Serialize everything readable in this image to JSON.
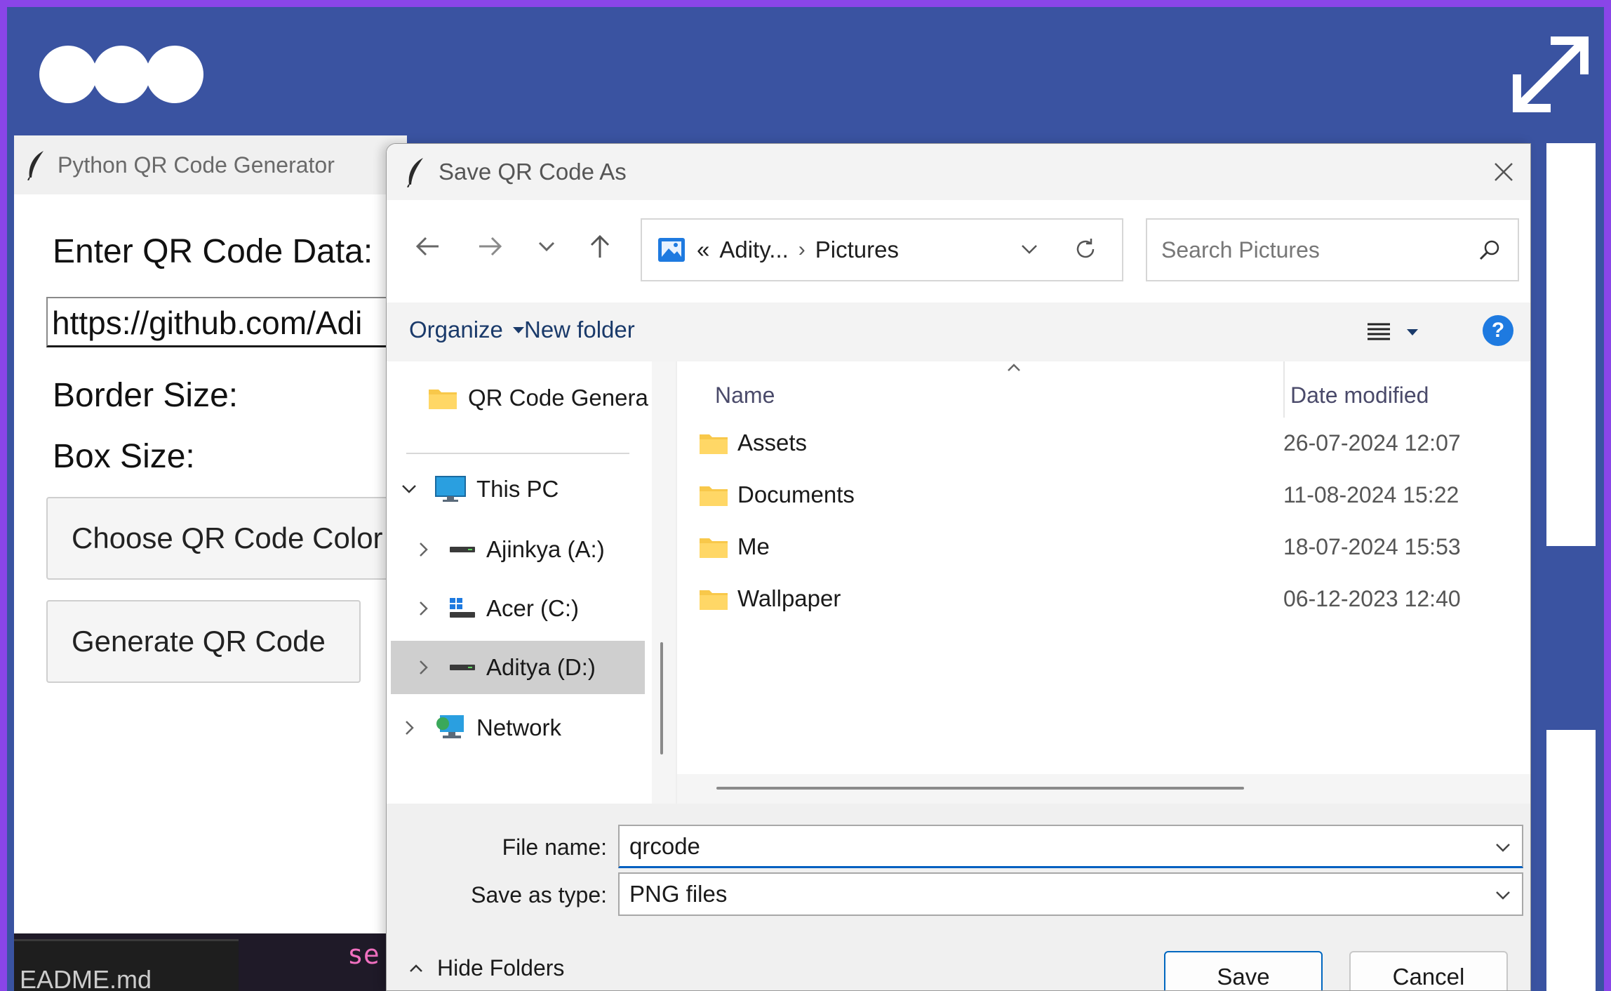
{
  "frame": {
    "colors": {
      "background": "#3a53a1",
      "border": "#8a45e8",
      "dots": "#ffffff"
    },
    "controls": [
      "window-dot-icon",
      "window-dot-icon",
      "window-dot-icon",
      "expand-icon"
    ]
  },
  "qr_app": {
    "title": "Python QR Code Generator",
    "icon": "feather-icon",
    "data_label": "Enter QR Code Data:",
    "data_value": "https://github.com/Adi",
    "border_label": "Border Size:",
    "box_label": "Box Size:",
    "color_button": "Choose QR Code Color",
    "generate_button": "Generate QR Code"
  },
  "terminal": {
    "filename": "EADME.md",
    "code": "se"
  },
  "dialog": {
    "title": "Save QR Code As",
    "icon": "feather-icon",
    "nav": {
      "back": "back-arrow-icon",
      "forward": "forward-arrow-icon",
      "recent": "chevron-down-icon",
      "up": "up-arrow-icon"
    },
    "address": {
      "overflow": "«",
      "crumbs": [
        "Adity...",
        "Pictures"
      ],
      "separator": "›"
    },
    "search": {
      "placeholder": "Search Pictures"
    },
    "toolbar": {
      "organize": "Organize",
      "new_folder": "New folder",
      "help": "?"
    },
    "nav_pane": [
      {
        "label": "QR Code Genera",
        "icon": "folder-icon"
      },
      {
        "label": "This PC",
        "icon": "monitor-icon"
      },
      {
        "label": "Ajinkya (A:)",
        "icon": "drive-icon"
      },
      {
        "label": "Acer (C:)",
        "icon": "windows-drive-icon"
      },
      {
        "label": "Aditya (D:)",
        "icon": "drive-icon",
        "selected": true
      },
      {
        "label": "Network",
        "icon": "network-icon"
      }
    ],
    "columns": {
      "name": "Name",
      "date": "Date modified"
    },
    "files": [
      {
        "name": "Assets",
        "date": "26-07-2024 12:07"
      },
      {
        "name": "Documents",
        "date": "11-08-2024 15:22"
      },
      {
        "name": "Me",
        "date": "18-07-2024 15:53"
      },
      {
        "name": "Wallpaper",
        "date": "06-12-2023 12:40"
      }
    ],
    "file_name_label": "File name:",
    "file_name_value": "qrcode",
    "save_type_label": "Save as type:",
    "save_type_value": "PNG files",
    "hide_folders": "Hide Folders",
    "save_button": "Save",
    "cancel_button": "Cancel",
    "colors": {
      "folder": "#f8c84a",
      "accent": "#0067c0",
      "help": "#1e7ae0"
    }
  }
}
